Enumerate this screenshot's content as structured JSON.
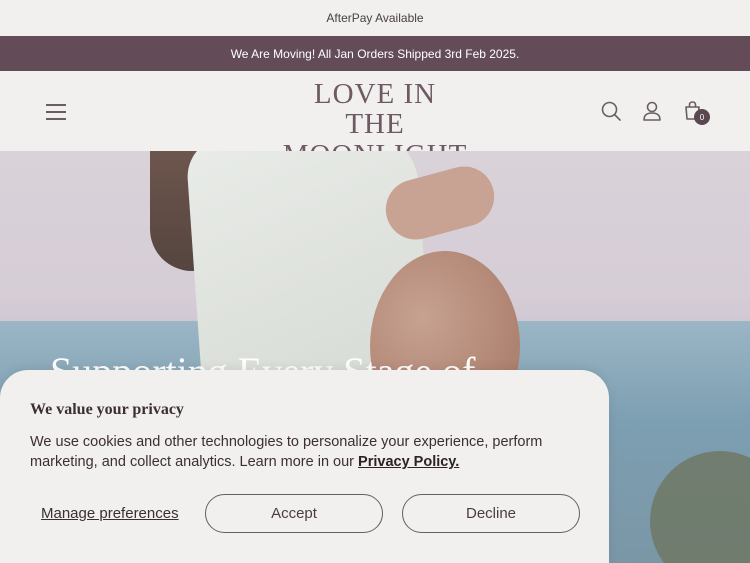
{
  "announcement": {
    "top_text": "AfterPay Available",
    "bar_text": "We Are Moving! All Jan Orders Shipped 3rd Feb 2025."
  },
  "header": {
    "logo_line1": "LOVE IN THE",
    "logo_line2": "MOONLIGHT",
    "cart_count": "0",
    "icons": [
      "menu-icon",
      "search-icon",
      "account-icon",
      "cart-icon"
    ]
  },
  "hero": {
    "heading": "Supporting Every Stage of"
  },
  "privacy": {
    "title": "We value your privacy",
    "body": "We use cookies and other technologies to personalize your experience, perform marketing, and collect analytics. Learn more in our ",
    "policy_link": "Privacy Policy.",
    "manage_label": "Manage preferences",
    "accept_label": "Accept",
    "decline_label": "Decline"
  },
  "colors": {
    "brand": "#634c58",
    "background": "#f1f0ef",
    "text": "#3c2f33"
  }
}
